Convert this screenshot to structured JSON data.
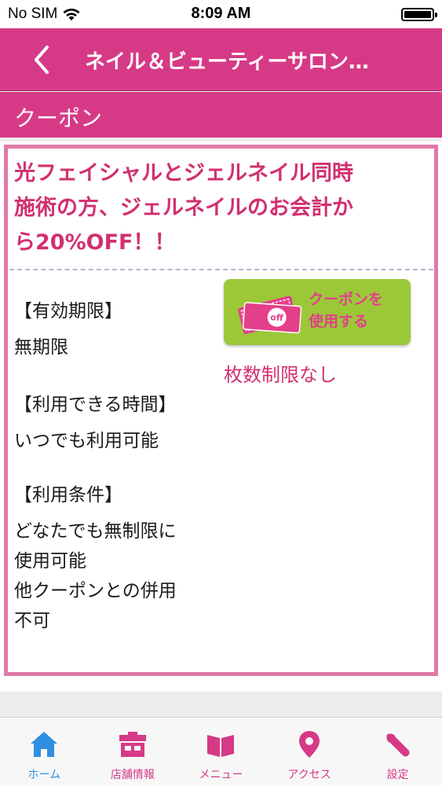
{
  "status_bar": {
    "carrier": "No SIM",
    "time": "8:09 AM"
  },
  "nav": {
    "title": "ネイル＆ビューティーサロン…"
  },
  "section": {
    "title": "クーポン"
  },
  "coupon": {
    "title_lines": [
      "光フェイシャルとジェルネイル同時",
      "施術の方、ジェルネイルのお会計か",
      "ら20%OFF！！"
    ],
    "validity_heading": "【有効期限】",
    "validity_value": "無期限",
    "hours_heading": "【利用できる時間】",
    "hours_value": "いつでも利用可能",
    "conditions_heading": "【利用条件】",
    "conditions_lines": [
      "どなたでも無制限に",
      "使用可能",
      "他クーポンとの併用",
      "不可"
    ],
    "use_button_lines": [
      "クーポンを",
      "使用する"
    ],
    "ticket_badge": "off",
    "limit_text": "枚数制限なし"
  },
  "tabs": [
    {
      "label": "ホーム",
      "icon": "home-icon",
      "active": true
    },
    {
      "label": "店舗情報",
      "icon": "shop-icon",
      "active": false
    },
    {
      "label": "メニュー",
      "icon": "book-icon",
      "active": false
    },
    {
      "label": "アクセス",
      "icon": "map-pin-icon",
      "active": false
    },
    {
      "label": "設定",
      "icon": "wrench-icon",
      "active": false
    }
  ],
  "colors": {
    "brand_pink": "#d63a86",
    "coupon_text": "#d1306f",
    "button_green": "#9cc838",
    "active_tab": "#2f8fe0"
  }
}
